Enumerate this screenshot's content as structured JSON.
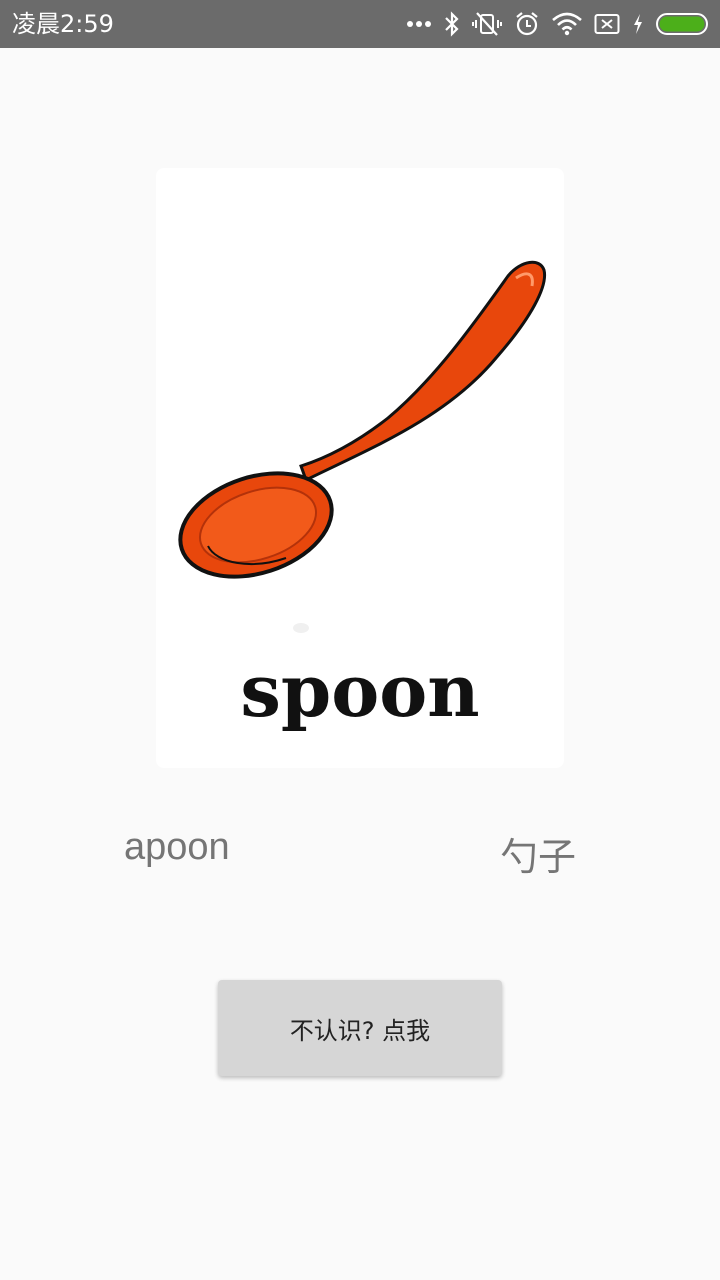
{
  "status_bar": {
    "time": "凌晨2:59",
    "icons": [
      "more-dots-icon",
      "bluetooth-icon",
      "vibrate-off-icon",
      "alarm-icon",
      "wifi-icon",
      "no-sim-icon",
      "charging-icon",
      "battery-icon"
    ],
    "battery_color": "#4caf1a"
  },
  "card": {
    "image_caption": "spoon",
    "spoon_color": "#e8470c"
  },
  "word": {
    "english": "apoon",
    "chinese": "勺子"
  },
  "help_button": {
    "label": "不认识? 点我"
  }
}
